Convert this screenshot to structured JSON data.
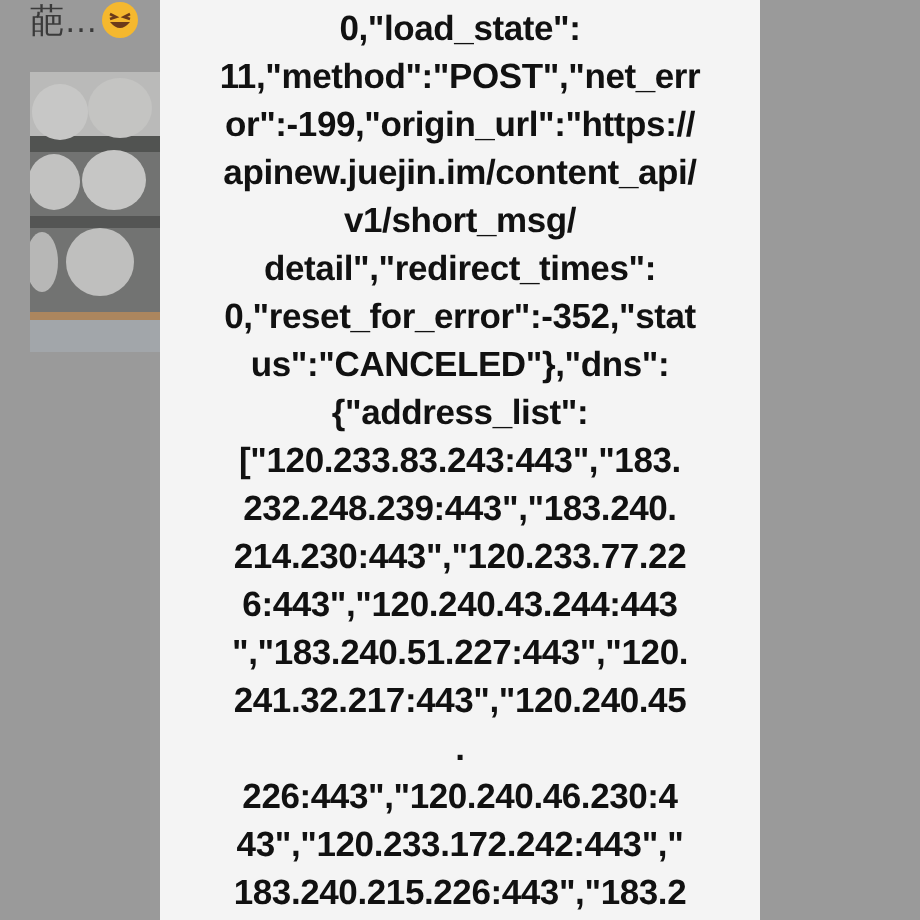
{
  "background_post": {
    "text": "葩…"
  },
  "alert": {
    "message_lines": [
      "0,\"load_state\":",
      "11,\"method\":\"POST\",\"net_err",
      "or\":-199,\"origin_url\":\"https://",
      "apinew.juejin.im/content_api/",
      "v1/short_msg/",
      "detail\",\"redirect_times\":",
      "0,\"reset_for_error\":-352,\"stat",
      "us\":\"CANCELED\"},\"dns\":",
      "{\"address_list\":",
      "[\"120.233.83.243:443\",\"183.",
      "232.248.239:443\",\"183.240.",
      "214.230:443\",\"120.233.77.22",
      "6:443\",\"120.240.43.244:443",
      "\",\"183.240.51.227:443\",\"120.",
      "241.32.217:443\",\"120.240.45",
      ".",
      "226:443\",\"120.240.46.230:4",
      "43\",\"120.233.172.242:443\",\"",
      "183.240.215.226:443\",\"183.2"
    ]
  }
}
